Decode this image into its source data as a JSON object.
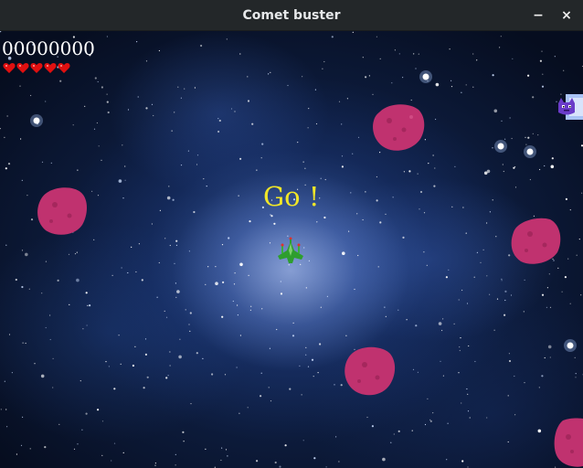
{
  "window": {
    "title": "Comet buster",
    "minimize_label": "−",
    "close_label": "×"
  },
  "hud": {
    "score": "00000000",
    "lives": 5
  },
  "message": {
    "text": "Go !"
  },
  "colors": {
    "titlebar_bg": "#232729",
    "message": "#f0e628",
    "asteroid": "#c0326f",
    "ship": "#2e9e2e",
    "heart": "#e01010"
  },
  "sprites": {
    "player": "spaceship-icon",
    "enemy": "nyan-cat-icon",
    "asteroid": "asteroid-icon",
    "life": "heart-icon"
  }
}
